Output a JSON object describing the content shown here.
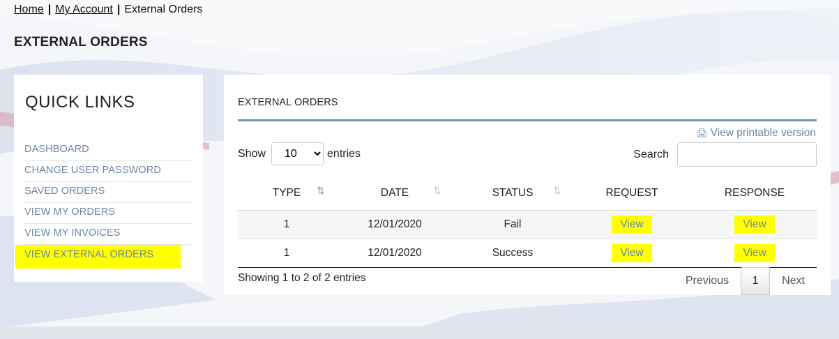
{
  "breadcrumb": {
    "home": "Home",
    "account": "My Account",
    "current": "External Orders",
    "sep": "|"
  },
  "page_title": "EXTERNAL ORDERS",
  "quick_links": {
    "title": "QUICK LINKS",
    "items": [
      {
        "label": "DASHBOARD"
      },
      {
        "label": "CHANGE USER PASSWORD"
      },
      {
        "label": "SAVED ORDERS"
      },
      {
        "label": "VIEW MY ORDERS"
      },
      {
        "label": "VIEW MY INVOICES"
      },
      {
        "label": "VIEW EXTERNAL ORDERS"
      }
    ]
  },
  "card": {
    "title": "EXTERNAL ORDERS",
    "printable": "View printable version",
    "printable_icon": "print-icon",
    "show_label": "Show",
    "entries_value": "10",
    "entries_label": "entries",
    "search_label": "Search",
    "search_value": "",
    "columns": [
      "TYPE",
      "DATE",
      "STATUS",
      "REQUEST",
      "RESPONSE"
    ],
    "rows": [
      {
        "type": "1",
        "date": "12/01/2020",
        "status": "Fail",
        "request": "View",
        "response": "View"
      },
      {
        "type": "1",
        "date": "12/01/2020",
        "status": "Success",
        "request": "View",
        "response": "View"
      }
    ],
    "info": "Showing 1 to 2 of 2 entries",
    "pager": {
      "previous": "Previous",
      "page": "1",
      "next": "Next"
    }
  },
  "colors": {
    "link": "#6b86a6",
    "highlight": "#ffff00",
    "rule": "#7c90a6"
  }
}
